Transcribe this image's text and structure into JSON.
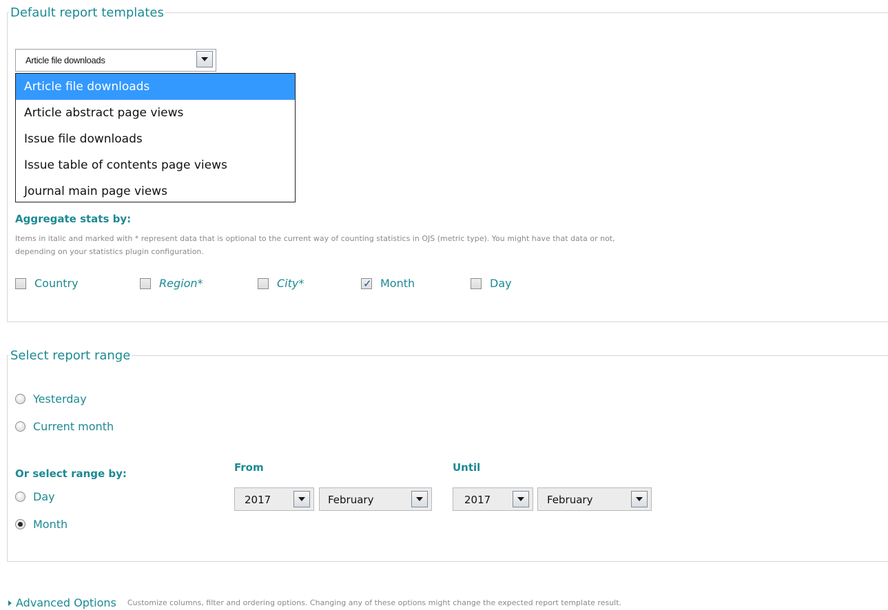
{
  "templates": {
    "legend": "Default report templates",
    "selected": "Article file downloads",
    "options": [
      "Article file downloads",
      "Article abstract page views",
      "Issue file downloads",
      "Issue table of contents page views",
      "Journal main page views"
    ]
  },
  "aggregate": {
    "heading": "Aggregate stats by:",
    "note_line1": "Items in italic and marked with * represent data that is optional to the current way of counting statistics in OJS (metric type). You might have that data or not,",
    "note_line2": "depending on your statistics plugin configuration.",
    "options": [
      {
        "label": "Country",
        "checked": false,
        "italic": false
      },
      {
        "label": "Region*",
        "checked": false,
        "italic": true
      },
      {
        "label": "City*",
        "checked": false,
        "italic": true
      },
      {
        "label": "Month",
        "checked": true,
        "italic": false
      },
      {
        "label": "Day",
        "checked": false,
        "italic": false
      }
    ]
  },
  "range": {
    "legend": "Select report range",
    "yesterday": "Yesterday",
    "current_month": "Current month",
    "or_select": "Or select range by:",
    "day": "Day",
    "month": "Month",
    "selected_mode": "Month",
    "from_label": "From",
    "until_label": "Until",
    "from_year": "2017",
    "from_month": "February",
    "until_year": "2017",
    "until_month": "February"
  },
  "advanced": {
    "link": "Advanced Options",
    "description": "Customize columns, filter and ordering options. Changing any of these options might change the expected report template result."
  }
}
